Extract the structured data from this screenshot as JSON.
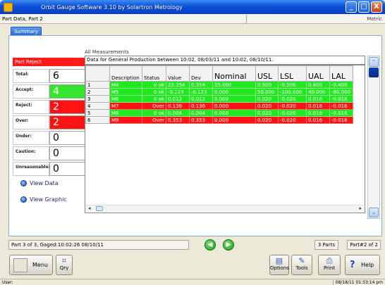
{
  "window": {
    "title": "Orbit Gauge Software 3.10 by Solartron Metrology",
    "min_label": "_",
    "max_label": "□",
    "close_label": "X"
  },
  "pathbar": {
    "path": "Part Data, Part 2",
    "units": "Metric"
  },
  "tabs": [
    {
      "label": "Summary"
    }
  ],
  "summary": {
    "banner": "Part Reject",
    "stats": [
      {
        "label": "Total:",
        "value": "6",
        "color": "#ffffff"
      },
      {
        "label": "Accept:",
        "value": "4",
        "color": "#33e62c"
      },
      {
        "label": "Reject:",
        "value": "2",
        "color": "#ff1212"
      },
      {
        "label": "Over:",
        "value": "2",
        "color": "#ff1212"
      },
      {
        "label": "Under:",
        "value": "0",
        "color": "#ffffff"
      },
      {
        "label": "Caution:",
        "value": "0",
        "color": "#ffffff"
      },
      {
        "label": "Unreasonable:",
        "value": "0",
        "color": "#ffffff"
      }
    ],
    "view_data_label": "View Data",
    "view_graphic_label": "View Graphic"
  },
  "measurements": {
    "title": "All Measurements",
    "info": "Data for General Production between 10:02, 08/03/11 and 10:02, 08/10/11.",
    "columns": [
      "",
      "Description",
      "Status",
      "Value",
      "Dev",
      "Nominal",
      "USL",
      "LSL",
      "UAL",
      "LAL"
    ],
    "rows": [
      [
        "1",
        "M4",
        "0 ok",
        "25.354",
        "0.354",
        "25.000",
        "0.500",
        "-0.500",
        "0.400",
        "-0.400"
      ],
      [
        "2",
        "M5",
        "0 ok",
        "-0.123",
        "-0.123",
        "0.000",
        "50.000",
        "-100.000",
        "40.000",
        "-80.000"
      ],
      [
        "3",
        "M6",
        "0 ok",
        "0.012",
        "0.012",
        "0.000",
        "0.020",
        "-0.020",
        "0.016",
        "-0.016"
      ],
      [
        "4",
        "M7",
        "Over",
        "0.136",
        "0.136",
        "0.000",
        "0.020",
        "-0.020",
        "0.016",
        "-0.016"
      ],
      [
        "5",
        "M8",
        "0 ok",
        "0.004",
        "0.004",
        "0.000",
        "0.020",
        "-0.020",
        "0.016",
        "-0.016"
      ],
      [
        "6",
        "M9",
        "Over",
        "0.353",
        "0.353",
        "0.000",
        "0.020",
        "-0.020",
        "0.016",
        "-0.016"
      ]
    ],
    "row_status": [
      "ok",
      "ok",
      "ok",
      "over",
      "ok",
      "over"
    ]
  },
  "status": {
    "left": "Part 3 of 3, Gaged:10:02:26 08/10/11",
    "parts": "3 Parts",
    "part": "Part#2 of 2",
    "prev_label": "◀",
    "next_label": "▶"
  },
  "toolbar": {
    "menu_label": "Menu",
    "qry_label": "Qry",
    "options_label": "Options",
    "tools_label": "Tools",
    "print_label": "Print",
    "help_label": "Help"
  },
  "footer": {
    "user": "User:",
    "timestamp": "08/18/11 01:33:14 pm"
  }
}
